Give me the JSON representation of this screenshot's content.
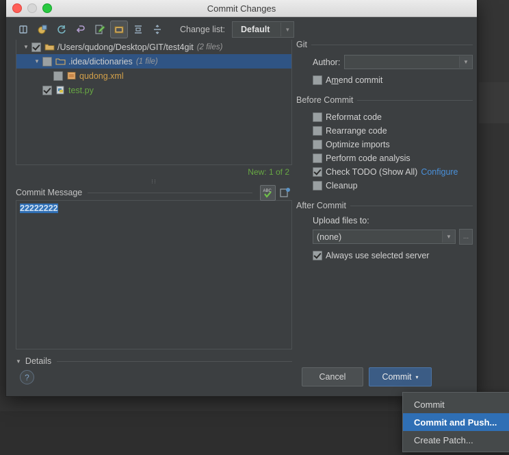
{
  "window": {
    "title": "Commit Changes",
    "traffic_lights": [
      "close-button",
      "minimize-button",
      "zoom-button"
    ]
  },
  "toolbar": {
    "icons": [
      {
        "name": "show-diff-icon",
        "glyph": "⌷"
      },
      {
        "name": "revert-icon",
        "glyph": "↺"
      },
      {
        "name": "refresh-icon",
        "glyph": "⟳"
      },
      {
        "name": "rollback-icon",
        "glyph": "↩"
      },
      {
        "name": "edit-source-icon",
        "glyph": "✎"
      },
      {
        "name": "group-by-directory-icon",
        "glyph": "▣"
      },
      {
        "name": "expand-all-icon",
        "glyph": "≡"
      },
      {
        "name": "collapse-all-icon",
        "glyph": "∴"
      }
    ],
    "change_list_label": "Change list:",
    "change_list_value": "Default"
  },
  "tree": {
    "rows": [
      {
        "indent": 0,
        "twisty": "▼",
        "checkbox": "checked",
        "icon": "folder-icon",
        "label": "/Users/qudong/Desktop/GIT/test4git",
        "meta": "(2 files)",
        "style": "path",
        "selected": false
      },
      {
        "indent": 1,
        "twisty": "▼",
        "checkbox": "unchecked",
        "icon": "folder-icon",
        "label": ".idea/dictionaries",
        "meta": "(1 file)",
        "style": "path",
        "selected": true
      },
      {
        "indent": 2,
        "twisty": "",
        "checkbox": "unchecked",
        "icon": "xml-file-icon",
        "label": "qudong.xml",
        "meta": "",
        "style": "modified",
        "selected": false
      },
      {
        "indent": 1,
        "twisty": "",
        "checkbox": "checked",
        "icon": "python-file-icon",
        "label": "test.py",
        "meta": "",
        "style": "new",
        "selected": false
      }
    ],
    "status": "New: 1 of 2"
  },
  "commit_message": {
    "label": "Commit Message",
    "value": "22222222",
    "placeholder": "",
    "icons": [
      {
        "name": "spellcheck-icon",
        "glyph": "ABC"
      },
      {
        "name": "message-history-icon",
        "glyph": "❐"
      }
    ]
  },
  "details": {
    "label": "Details",
    "twisty": "▼"
  },
  "git_section": {
    "title": "Git",
    "author_label": "Author:",
    "author_value": "",
    "amend_label": "Amend commit",
    "amend_checked": false
  },
  "before_commit": {
    "title": "Before Commit",
    "items": [
      {
        "label": "Reformat code",
        "checked": false,
        "link": ""
      },
      {
        "label": "Rearrange code",
        "checked": false,
        "link": ""
      },
      {
        "label": "Optimize imports",
        "checked": false,
        "link": ""
      },
      {
        "label": "Perform code analysis",
        "checked": false,
        "link": ""
      },
      {
        "label": "Check TODO (Show All)",
        "checked": true,
        "link": "Configure"
      },
      {
        "label": "Cleanup",
        "checked": false,
        "link": ""
      }
    ]
  },
  "after_commit": {
    "title": "After Commit",
    "upload_label": "Upload files to:",
    "upload_value": "(none)",
    "ellipsis_label": "...",
    "always_label": "Always use selected server",
    "always_checked": true
  },
  "footer": {
    "help_glyph": "?",
    "cancel_label": "Cancel",
    "commit_label": "Commit",
    "commit_caret": "▾"
  },
  "menu": {
    "items": [
      {
        "label": "Commit",
        "highlighted": false
      },
      {
        "label": "Commit and Push...",
        "highlighted": true
      },
      {
        "label": "Create Patch...",
        "highlighted": false
      }
    ]
  },
  "colors": {
    "accent_blue": "#2f6fb5",
    "selection_blue": "#2f5484",
    "new_green": "#68a843",
    "modified_orange": "#d3a04a",
    "link_blue": "#4a90d9",
    "window_bg": "#3c3f41"
  }
}
